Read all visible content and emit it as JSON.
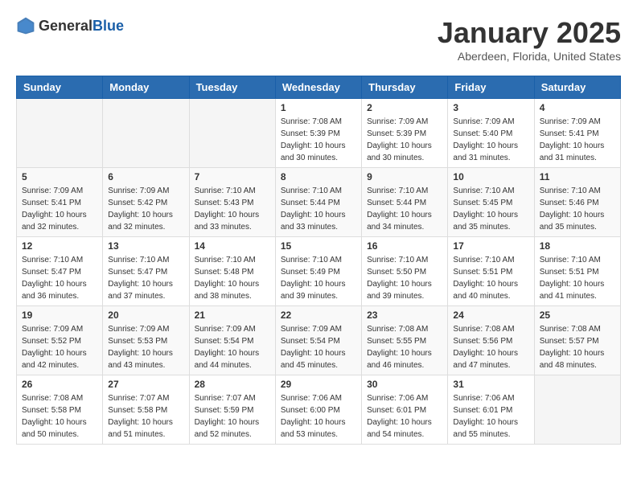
{
  "header": {
    "logo_general": "General",
    "logo_blue": "Blue",
    "title": "January 2025",
    "location": "Aberdeen, Florida, United States"
  },
  "weekdays": [
    "Sunday",
    "Monday",
    "Tuesday",
    "Wednesday",
    "Thursday",
    "Friday",
    "Saturday"
  ],
  "weeks": [
    [
      {
        "day": "",
        "sunrise": "",
        "sunset": "",
        "daylight": ""
      },
      {
        "day": "",
        "sunrise": "",
        "sunset": "",
        "daylight": ""
      },
      {
        "day": "",
        "sunrise": "",
        "sunset": "",
        "daylight": ""
      },
      {
        "day": "1",
        "sunrise": "Sunrise: 7:08 AM",
        "sunset": "Sunset: 5:39 PM",
        "daylight": "Daylight: 10 hours and 30 minutes."
      },
      {
        "day": "2",
        "sunrise": "Sunrise: 7:09 AM",
        "sunset": "Sunset: 5:39 PM",
        "daylight": "Daylight: 10 hours and 30 minutes."
      },
      {
        "day": "3",
        "sunrise": "Sunrise: 7:09 AM",
        "sunset": "Sunset: 5:40 PM",
        "daylight": "Daylight: 10 hours and 31 minutes."
      },
      {
        "day": "4",
        "sunrise": "Sunrise: 7:09 AM",
        "sunset": "Sunset: 5:41 PM",
        "daylight": "Daylight: 10 hours and 31 minutes."
      }
    ],
    [
      {
        "day": "5",
        "sunrise": "Sunrise: 7:09 AM",
        "sunset": "Sunset: 5:41 PM",
        "daylight": "Daylight: 10 hours and 32 minutes."
      },
      {
        "day": "6",
        "sunrise": "Sunrise: 7:09 AM",
        "sunset": "Sunset: 5:42 PM",
        "daylight": "Daylight: 10 hours and 32 minutes."
      },
      {
        "day": "7",
        "sunrise": "Sunrise: 7:10 AM",
        "sunset": "Sunset: 5:43 PM",
        "daylight": "Daylight: 10 hours and 33 minutes."
      },
      {
        "day": "8",
        "sunrise": "Sunrise: 7:10 AM",
        "sunset": "Sunset: 5:44 PM",
        "daylight": "Daylight: 10 hours and 33 minutes."
      },
      {
        "day": "9",
        "sunrise": "Sunrise: 7:10 AM",
        "sunset": "Sunset: 5:44 PM",
        "daylight": "Daylight: 10 hours and 34 minutes."
      },
      {
        "day": "10",
        "sunrise": "Sunrise: 7:10 AM",
        "sunset": "Sunset: 5:45 PM",
        "daylight": "Daylight: 10 hours and 35 minutes."
      },
      {
        "day": "11",
        "sunrise": "Sunrise: 7:10 AM",
        "sunset": "Sunset: 5:46 PM",
        "daylight": "Daylight: 10 hours and 35 minutes."
      }
    ],
    [
      {
        "day": "12",
        "sunrise": "Sunrise: 7:10 AM",
        "sunset": "Sunset: 5:47 PM",
        "daylight": "Daylight: 10 hours and 36 minutes."
      },
      {
        "day": "13",
        "sunrise": "Sunrise: 7:10 AM",
        "sunset": "Sunset: 5:47 PM",
        "daylight": "Daylight: 10 hours and 37 minutes."
      },
      {
        "day": "14",
        "sunrise": "Sunrise: 7:10 AM",
        "sunset": "Sunset: 5:48 PM",
        "daylight": "Daylight: 10 hours and 38 minutes."
      },
      {
        "day": "15",
        "sunrise": "Sunrise: 7:10 AM",
        "sunset": "Sunset: 5:49 PM",
        "daylight": "Daylight: 10 hours and 39 minutes."
      },
      {
        "day": "16",
        "sunrise": "Sunrise: 7:10 AM",
        "sunset": "Sunset: 5:50 PM",
        "daylight": "Daylight: 10 hours and 39 minutes."
      },
      {
        "day": "17",
        "sunrise": "Sunrise: 7:10 AM",
        "sunset": "Sunset: 5:51 PM",
        "daylight": "Daylight: 10 hours and 40 minutes."
      },
      {
        "day": "18",
        "sunrise": "Sunrise: 7:10 AM",
        "sunset": "Sunset: 5:51 PM",
        "daylight": "Daylight: 10 hours and 41 minutes."
      }
    ],
    [
      {
        "day": "19",
        "sunrise": "Sunrise: 7:09 AM",
        "sunset": "Sunset: 5:52 PM",
        "daylight": "Daylight: 10 hours and 42 minutes."
      },
      {
        "day": "20",
        "sunrise": "Sunrise: 7:09 AM",
        "sunset": "Sunset: 5:53 PM",
        "daylight": "Daylight: 10 hours and 43 minutes."
      },
      {
        "day": "21",
        "sunrise": "Sunrise: 7:09 AM",
        "sunset": "Sunset: 5:54 PM",
        "daylight": "Daylight: 10 hours and 44 minutes."
      },
      {
        "day": "22",
        "sunrise": "Sunrise: 7:09 AM",
        "sunset": "Sunset: 5:54 PM",
        "daylight": "Daylight: 10 hours and 45 minutes."
      },
      {
        "day": "23",
        "sunrise": "Sunrise: 7:08 AM",
        "sunset": "Sunset: 5:55 PM",
        "daylight": "Daylight: 10 hours and 46 minutes."
      },
      {
        "day": "24",
        "sunrise": "Sunrise: 7:08 AM",
        "sunset": "Sunset: 5:56 PM",
        "daylight": "Daylight: 10 hours and 47 minutes."
      },
      {
        "day": "25",
        "sunrise": "Sunrise: 7:08 AM",
        "sunset": "Sunset: 5:57 PM",
        "daylight": "Daylight: 10 hours and 48 minutes."
      }
    ],
    [
      {
        "day": "26",
        "sunrise": "Sunrise: 7:08 AM",
        "sunset": "Sunset: 5:58 PM",
        "daylight": "Daylight: 10 hours and 50 minutes."
      },
      {
        "day": "27",
        "sunrise": "Sunrise: 7:07 AM",
        "sunset": "Sunset: 5:58 PM",
        "daylight": "Daylight: 10 hours and 51 minutes."
      },
      {
        "day": "28",
        "sunrise": "Sunrise: 7:07 AM",
        "sunset": "Sunset: 5:59 PM",
        "daylight": "Daylight: 10 hours and 52 minutes."
      },
      {
        "day": "29",
        "sunrise": "Sunrise: 7:06 AM",
        "sunset": "Sunset: 6:00 PM",
        "daylight": "Daylight: 10 hours and 53 minutes."
      },
      {
        "day": "30",
        "sunrise": "Sunrise: 7:06 AM",
        "sunset": "Sunset: 6:01 PM",
        "daylight": "Daylight: 10 hours and 54 minutes."
      },
      {
        "day": "31",
        "sunrise": "Sunrise: 7:06 AM",
        "sunset": "Sunset: 6:01 PM",
        "daylight": "Daylight: 10 hours and 55 minutes."
      },
      {
        "day": "",
        "sunrise": "",
        "sunset": "",
        "daylight": ""
      }
    ]
  ]
}
